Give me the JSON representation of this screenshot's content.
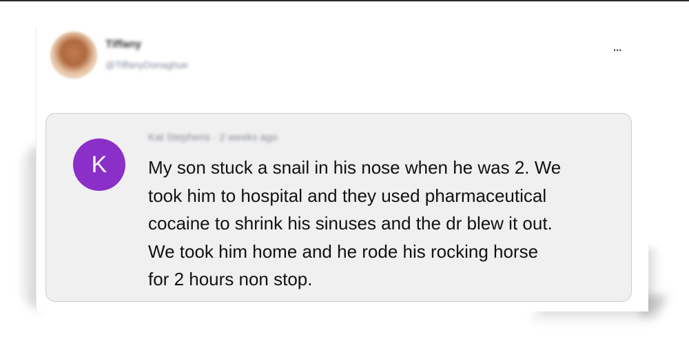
{
  "post": {
    "author_name": "Tiffany",
    "author_handle": "@TiffanyDonaghue",
    "more_icon": "ellipsis-icon",
    "more_label": "..."
  },
  "comment": {
    "avatar_letter": "K",
    "avatar_color": "#8a2fc8",
    "meta": "Kat Stephens · 2 weeks ago",
    "lines": [
      "My son stuck a snail in his nose when he was 2.  We",
      "took him to hospital and they used pharmaceutical",
      "cocaine to shrink his sinuses and the dr blew it out.",
      "We took him home and  he rode his rocking horse",
      "for 2 hours  non stop."
    ]
  }
}
